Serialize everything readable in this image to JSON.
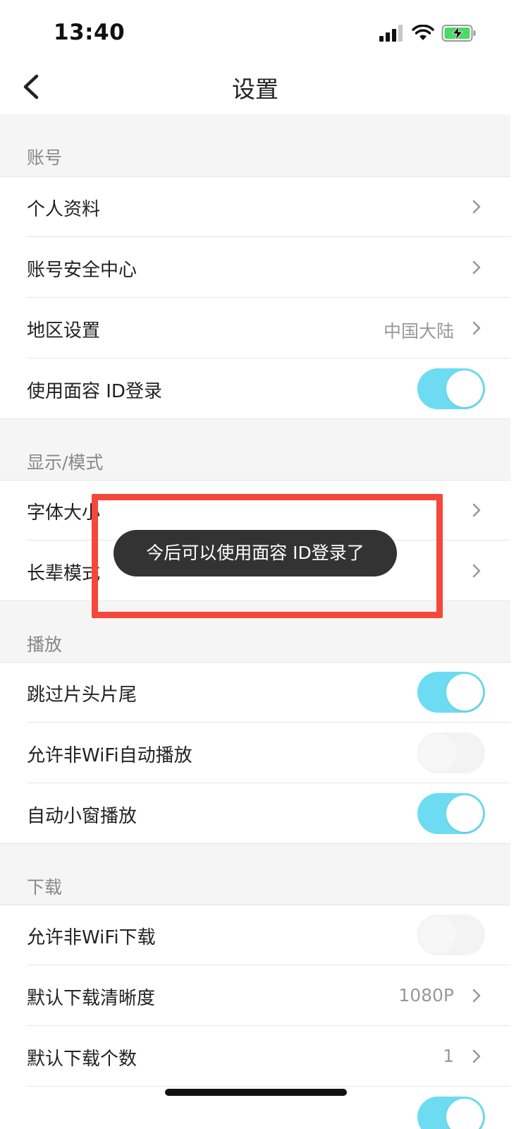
{
  "status_bar": {
    "time": "13:40"
  },
  "nav": {
    "title": "设置"
  },
  "sections": {
    "account": {
      "header": "账号",
      "profile": "个人资料",
      "security": "账号安全中心",
      "region": {
        "label": "地区设置",
        "value": "中国大陆"
      },
      "faceid": {
        "label": "使用面容 ID登录",
        "on": true
      }
    },
    "display": {
      "header": "显示/模式",
      "font_size": "字体大小",
      "elder_mode": "长辈模式"
    },
    "playback": {
      "header": "播放",
      "skip_intro": {
        "label": "跳过片头片尾",
        "on": true
      },
      "non_wifi_autoplay": {
        "label": "允许非WiFi自动播放",
        "on": false
      },
      "mini_window": {
        "label": "自动小窗播放",
        "on": true
      }
    },
    "download": {
      "header": "下载",
      "non_wifi_download": {
        "label": "允许非WiFi下载",
        "on": false
      },
      "default_quality": {
        "label": "默认下载清晰度",
        "value": "1080P"
      },
      "default_count": {
        "label": "默认下载个数",
        "value": "1"
      }
    }
  },
  "toast": {
    "text": "今后可以使用面容 ID登录了"
  },
  "colors": {
    "toggle_on": "#6ddcf2",
    "annotation": "#f5473a",
    "toast_bg": "#333333"
  }
}
